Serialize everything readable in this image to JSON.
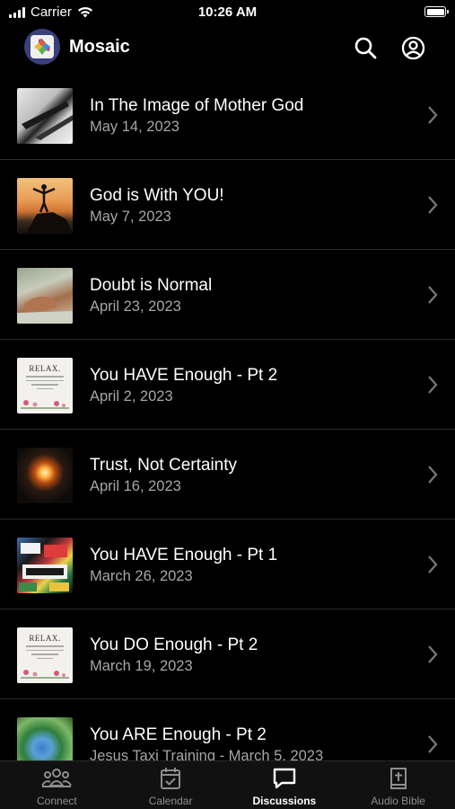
{
  "status_bar": {
    "carrier": "Carrier",
    "time": "10:26 AM"
  },
  "header": {
    "title": "Mosaic",
    "icons": [
      "search-icon",
      "account-icon"
    ]
  },
  "discussions": [
    {
      "title": "In The Image of Mother God",
      "date": "May 14, 2023"
    },
    {
      "title": "God is With YOU!",
      "date": "May 7, 2023"
    },
    {
      "title": "Doubt is Normal",
      "date": "April 23, 2023"
    },
    {
      "title": "You HAVE Enough - Pt 2",
      "date": "April 2, 2023",
      "thumb_text": "RELAX."
    },
    {
      "title": "Trust, Not Certainty",
      "date": "April 16, 2023"
    },
    {
      "title": "You HAVE Enough - Pt 1",
      "date": "March 26, 2023"
    },
    {
      "title": "You DO Enough - Pt 2",
      "date": "March 19, 2023",
      "thumb_text": "RELAX."
    },
    {
      "title": "You ARE Enough - Pt 2",
      "date": "Jesus Taxi Training - March 5, 2023"
    }
  ],
  "tabs": [
    {
      "label": "Connect",
      "icon": "group-icon",
      "active": false
    },
    {
      "label": "Calendar",
      "icon": "calendar-icon",
      "active": false
    },
    {
      "label": "Discussions",
      "icon": "chat-icon",
      "active": true
    },
    {
      "label": "Audio Bible",
      "icon": "bible-icon",
      "active": false
    }
  ],
  "colors": {
    "background": "#000000",
    "secondary_text": "#a6a6a6",
    "inactive_tab": "#8e8e8e"
  }
}
